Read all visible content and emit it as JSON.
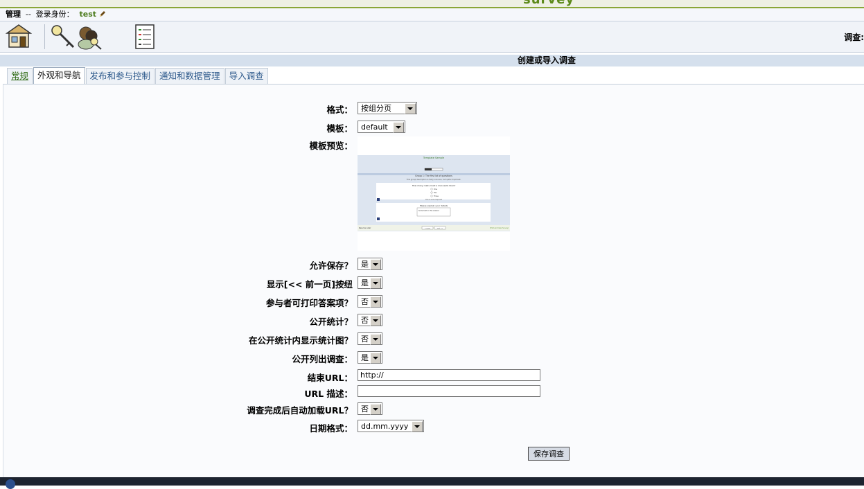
{
  "brand": "survey",
  "admin_bar": {
    "admin_label": "管理",
    "separator": "--",
    "role_label": "登录身份：",
    "username": "test"
  },
  "toolbar": {
    "icons": [
      "home-icon",
      "security-keys-icon",
      "survey-list-icon"
    ],
    "survey_label": "调查:"
  },
  "page_title": "创建或导入调查",
  "tabs": [
    "常规",
    "外观和导航",
    "发布和参与控制",
    "通知和数据管理",
    "导入调查"
  ],
  "active_tab": "外观和导航",
  "form": {
    "format": {
      "label": "格式：",
      "value": "按组分页"
    },
    "template": {
      "label": "模板：",
      "value": "default"
    },
    "template_preview": {
      "label": "模板预览："
    },
    "allow_save": {
      "label": "允许保存？",
      "value": "是"
    },
    "show_prev": {
      "label": "显示[<< 前一页]按纽",
      "value": "是"
    },
    "print_answers": {
      "label": "参与者可打印答案项？",
      "value": "否"
    },
    "public_stats": {
      "label": "公开统计？",
      "value": "否"
    },
    "public_graphs": {
      "label": "在公开统计内显示统计图？",
      "value": "否"
    },
    "public_list": {
      "label": "公开列出调查：",
      "value": "是"
    },
    "end_url": {
      "label": "结束URL：",
      "value": "http://"
    },
    "url_desc": {
      "label": "URL 描述：",
      "value": ""
    },
    "autoload_url": {
      "label": "调查完成后自动加载URL？",
      "value": "否"
    },
    "date_format": {
      "label": "日期格式：",
      "value": "dd.mm.yyyy"
    }
  },
  "save_button": "保存调查",
  "preview_image": {
    "heading": "Template Sample",
    "group_title": "Group 1: The first lot of questions",
    "group_desc": "This group description is fairly vacuous, but quite important.",
    "q1": "How many roads must a man walk down?",
    "q1_options": [
      "One",
      "Two",
      "Three"
    ],
    "q2": "Please explain your details",
    "q2_answer": "Some text in this answer",
    "help_text": "This is some help text",
    "resume_later": "Resume Later",
    "buttons": [
      "<< prev",
      "next >>"
    ],
    "exit_clear": "[Exit and Clear Survey]"
  },
  "colors": {
    "accent_green": "#5d8a1a",
    "title_bar": "#d5e0ed",
    "tab_text": "#2e5a8c"
  }
}
